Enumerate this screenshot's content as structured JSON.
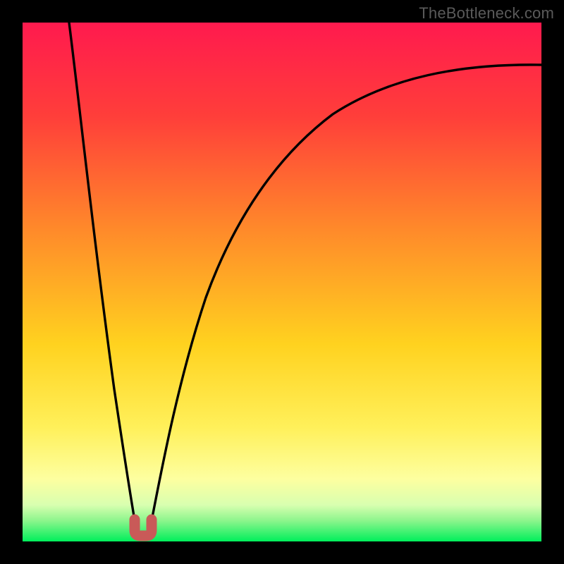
{
  "watermark": "TheBottleneck.com",
  "colors": {
    "gradient_top": "#ff1a47",
    "gradient_mid1": "#ff6a2a",
    "gradient_mid2": "#ffd21f",
    "gradient_mid3": "#fff78a",
    "gradient_bottom": "#00ef5b",
    "frame": "#000000",
    "curve": "#000000",
    "marker_fill": "#c85a5a",
    "marker_stroke": "#b24a4a"
  },
  "chart_data": {
    "type": "line",
    "title": "",
    "xlabel": "",
    "ylabel": "",
    "xlim": [
      0,
      100
    ],
    "ylim": [
      0,
      100
    ],
    "series": [
      {
        "name": "left-branch",
        "x": [
          9,
          11,
          13,
          15,
          17,
          19,
          20.5,
          22
        ],
        "y": [
          100,
          82,
          66,
          50,
          34,
          18,
          8,
          1
        ]
      },
      {
        "name": "right-branch",
        "x": [
          24,
          26,
          29,
          33,
          38,
          44,
          51,
          59,
          68,
          78,
          89,
          100
        ],
        "y": [
          1,
          11,
          25,
          40,
          52,
          62,
          70,
          76,
          81,
          85,
          88,
          90
        ]
      }
    ],
    "marker": {
      "name": "bottleneck-minimum",
      "x": 23,
      "y": 0
    }
  }
}
